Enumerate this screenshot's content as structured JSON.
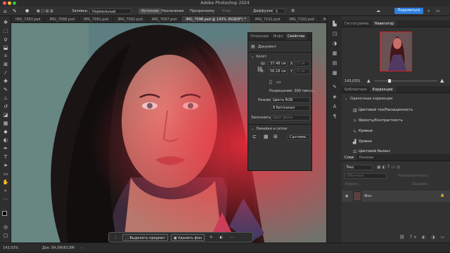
{
  "window": {
    "title": "Adobe Photoshop 2024"
  },
  "options_bar": {
    "fill_label": "Заливка:",
    "fill_value": "Нормальный",
    "source_button": "Источник",
    "dest_button": "Назначение",
    "transparent_button": "Прозрачному",
    "pattern_button": "Узор",
    "diffusion_label": "Диффузия:",
    "diffusion_value": "5",
    "share_button": "Поделиться"
  },
  "tabs": [
    {
      "label": "IMG_7083.psd"
    },
    {
      "label": "IMG_7088.psd"
    },
    {
      "label": "IMG_7091.psd"
    },
    {
      "label": "IMG_7092.psd"
    },
    {
      "label": "IMG_7097.psd"
    },
    {
      "label": "IMG_7098.psd @ 143% (RGB/8*) *"
    },
    {
      "label": "IMG_7101.psd"
    },
    {
      "label": "IMG_7102.psd"
    },
    {
      "label": "IMG_7103.ps"
    }
  ],
  "properties": {
    "tabs": [
      "Операции",
      "Инфо",
      "Свойства"
    ],
    "document_label": "Документ",
    "canvas_section": "Холст",
    "width_label": "Ш:",
    "width_value": "37,48 см",
    "height_label": "В:",
    "height_value": "56,18 см",
    "x_label": "X",
    "y_label": "Y",
    "x_value": "0 см",
    "y_value": "0 см",
    "resolution": "Разрешение: 300 пиксо...",
    "mode_label": "Режим",
    "mode_value": "Цвета RGB",
    "bits_value": "8 бит/канал",
    "fill_label": "Заполнить",
    "fill_value": "Цвет фона",
    "rulers_section": "Линейки и сетки",
    "units_value": "Сантиме..."
  },
  "navigator": {
    "tabs": [
      "Гистограмма",
      "Навигатор"
    ],
    "zoom": "143,03%"
  },
  "adjustments": {
    "tabs": [
      "Библиотеки",
      "Коррекции"
    ],
    "section": "Одиночные коррекции",
    "items": [
      "Цветовой тон/Насыщенность",
      "Яркость/Контрастность",
      "Кривые",
      "Уровни",
      "Цветовой баланс"
    ]
  },
  "layers": {
    "tabs": [
      "Слои",
      "Каналы"
    ],
    "search": "Вид",
    "blend_mode": "Обычные",
    "opacity_label": "Непрозрачность:",
    "lock_label": "Закреп.:",
    "fill_label": "Заливка:",
    "layer_name": "Фон"
  },
  "context_bar": {
    "select_subject": "Выделить предмет",
    "remove_bg": "Удалить фон"
  },
  "status": {
    "zoom": "143,03%",
    "doc": "Док: 84,0M/83,8M"
  },
  "colors": {
    "accent": "#2f7fe0",
    "panel": "#323232",
    "canvas_bg": "#5d7e80"
  }
}
